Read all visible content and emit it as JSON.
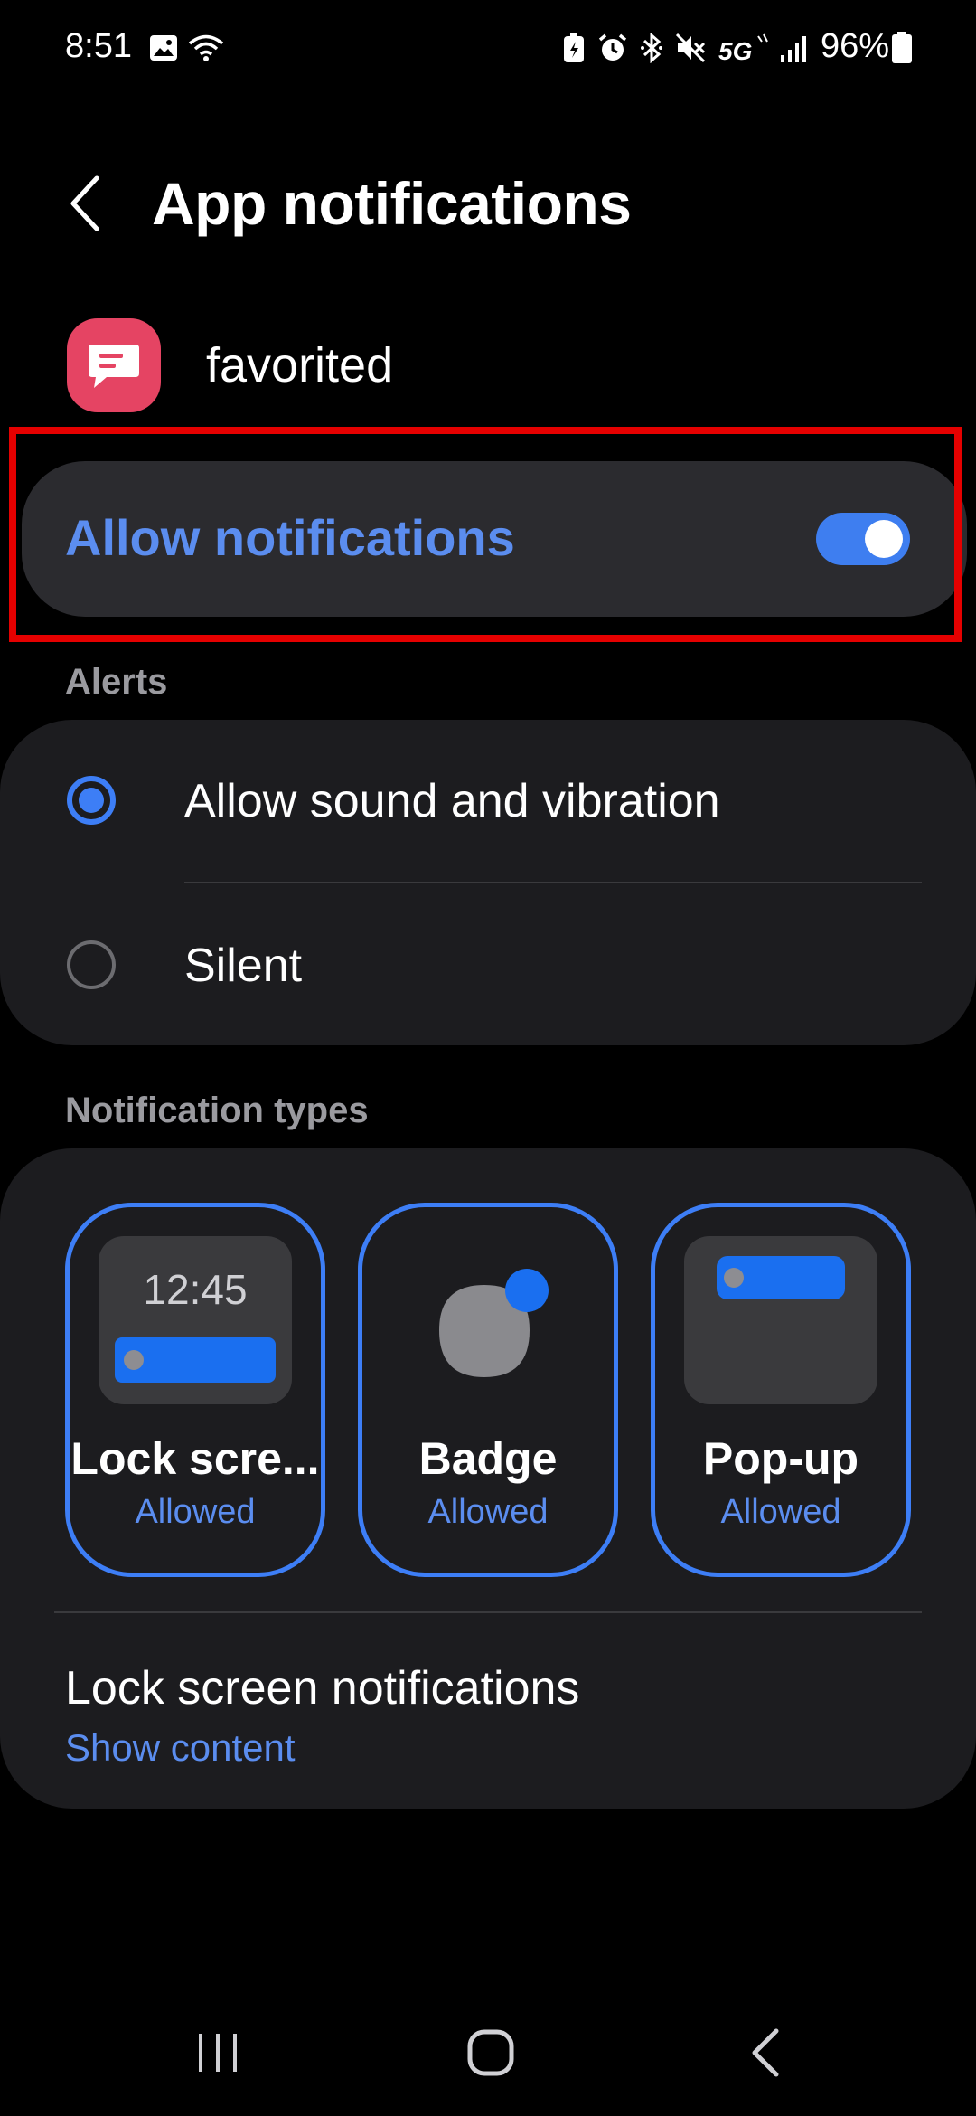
{
  "status_bar": {
    "time": "8:51",
    "battery_percent": "96%",
    "icons": [
      "gallery-icon",
      "wifi-icon",
      "battery-saver-icon",
      "alarm-icon",
      "bluetooth-icon",
      "mute-icon",
      "5g-icon",
      "signal-icon",
      "battery-icon"
    ]
  },
  "header": {
    "title": "App notifications"
  },
  "app": {
    "name": "favorited",
    "icon_color": "#e54463"
  },
  "allow_notifications": {
    "label": "Allow notifications",
    "enabled": true
  },
  "alerts": {
    "section_label": "Alerts",
    "options": [
      {
        "label": "Allow sound and vibration",
        "selected": true
      },
      {
        "label": "Silent",
        "selected": false
      }
    ]
  },
  "notification_types": {
    "section_label": "Notification types",
    "tiles": [
      {
        "name": "Lock scre...",
        "status": "Allowed",
        "preview_time": "12:45"
      },
      {
        "name": "Badge",
        "status": "Allowed"
      },
      {
        "name": "Pop-up",
        "status": "Allowed"
      }
    ]
  },
  "lock_screen_notifications": {
    "title": "Lock screen notifications",
    "value": "Show content"
  },
  "colors": {
    "accent": "#3d7ef6",
    "accent_text": "#5b8def",
    "highlight": "#e50000",
    "card": "#1c1c1f"
  }
}
